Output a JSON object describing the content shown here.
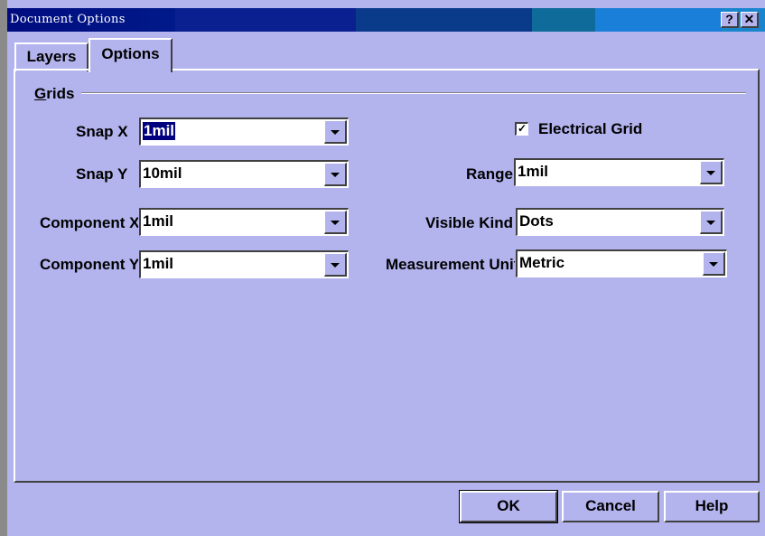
{
  "window": {
    "title": "Document Options"
  },
  "titlebar_buttons": {
    "help": "?",
    "close": "✕"
  },
  "tabs": [
    {
      "label": "Layers",
      "active": false
    },
    {
      "label": "Options",
      "active": true
    }
  ],
  "grids": {
    "group_label_accel": "G",
    "group_label_rest": "rids",
    "snap_x": {
      "label": "Snap X",
      "value": "1mil"
    },
    "snap_y": {
      "label": "Snap Y",
      "value": "10mil"
    },
    "component_x": {
      "label": "Component X",
      "value": "1mil"
    },
    "component_y": {
      "label": "Component Y",
      "value": "1mil"
    },
    "electrical_grid": {
      "label": "Electrical Grid",
      "checked": true,
      "mark": "✓"
    },
    "range": {
      "label": "Range",
      "value": "1mil"
    },
    "visible_kind": {
      "label": "Visible Kind",
      "value": "Dots"
    },
    "measurement_unit": {
      "label": "Measurement Unit",
      "value": "Metric"
    }
  },
  "buttons": {
    "ok": "OK",
    "cancel": "Cancel",
    "help": "Help"
  },
  "colors": {
    "dialog_bg": "#b3b3ee",
    "selection": "#00007f",
    "title_start": "#000c80",
    "title_end": "#1a84d0"
  }
}
